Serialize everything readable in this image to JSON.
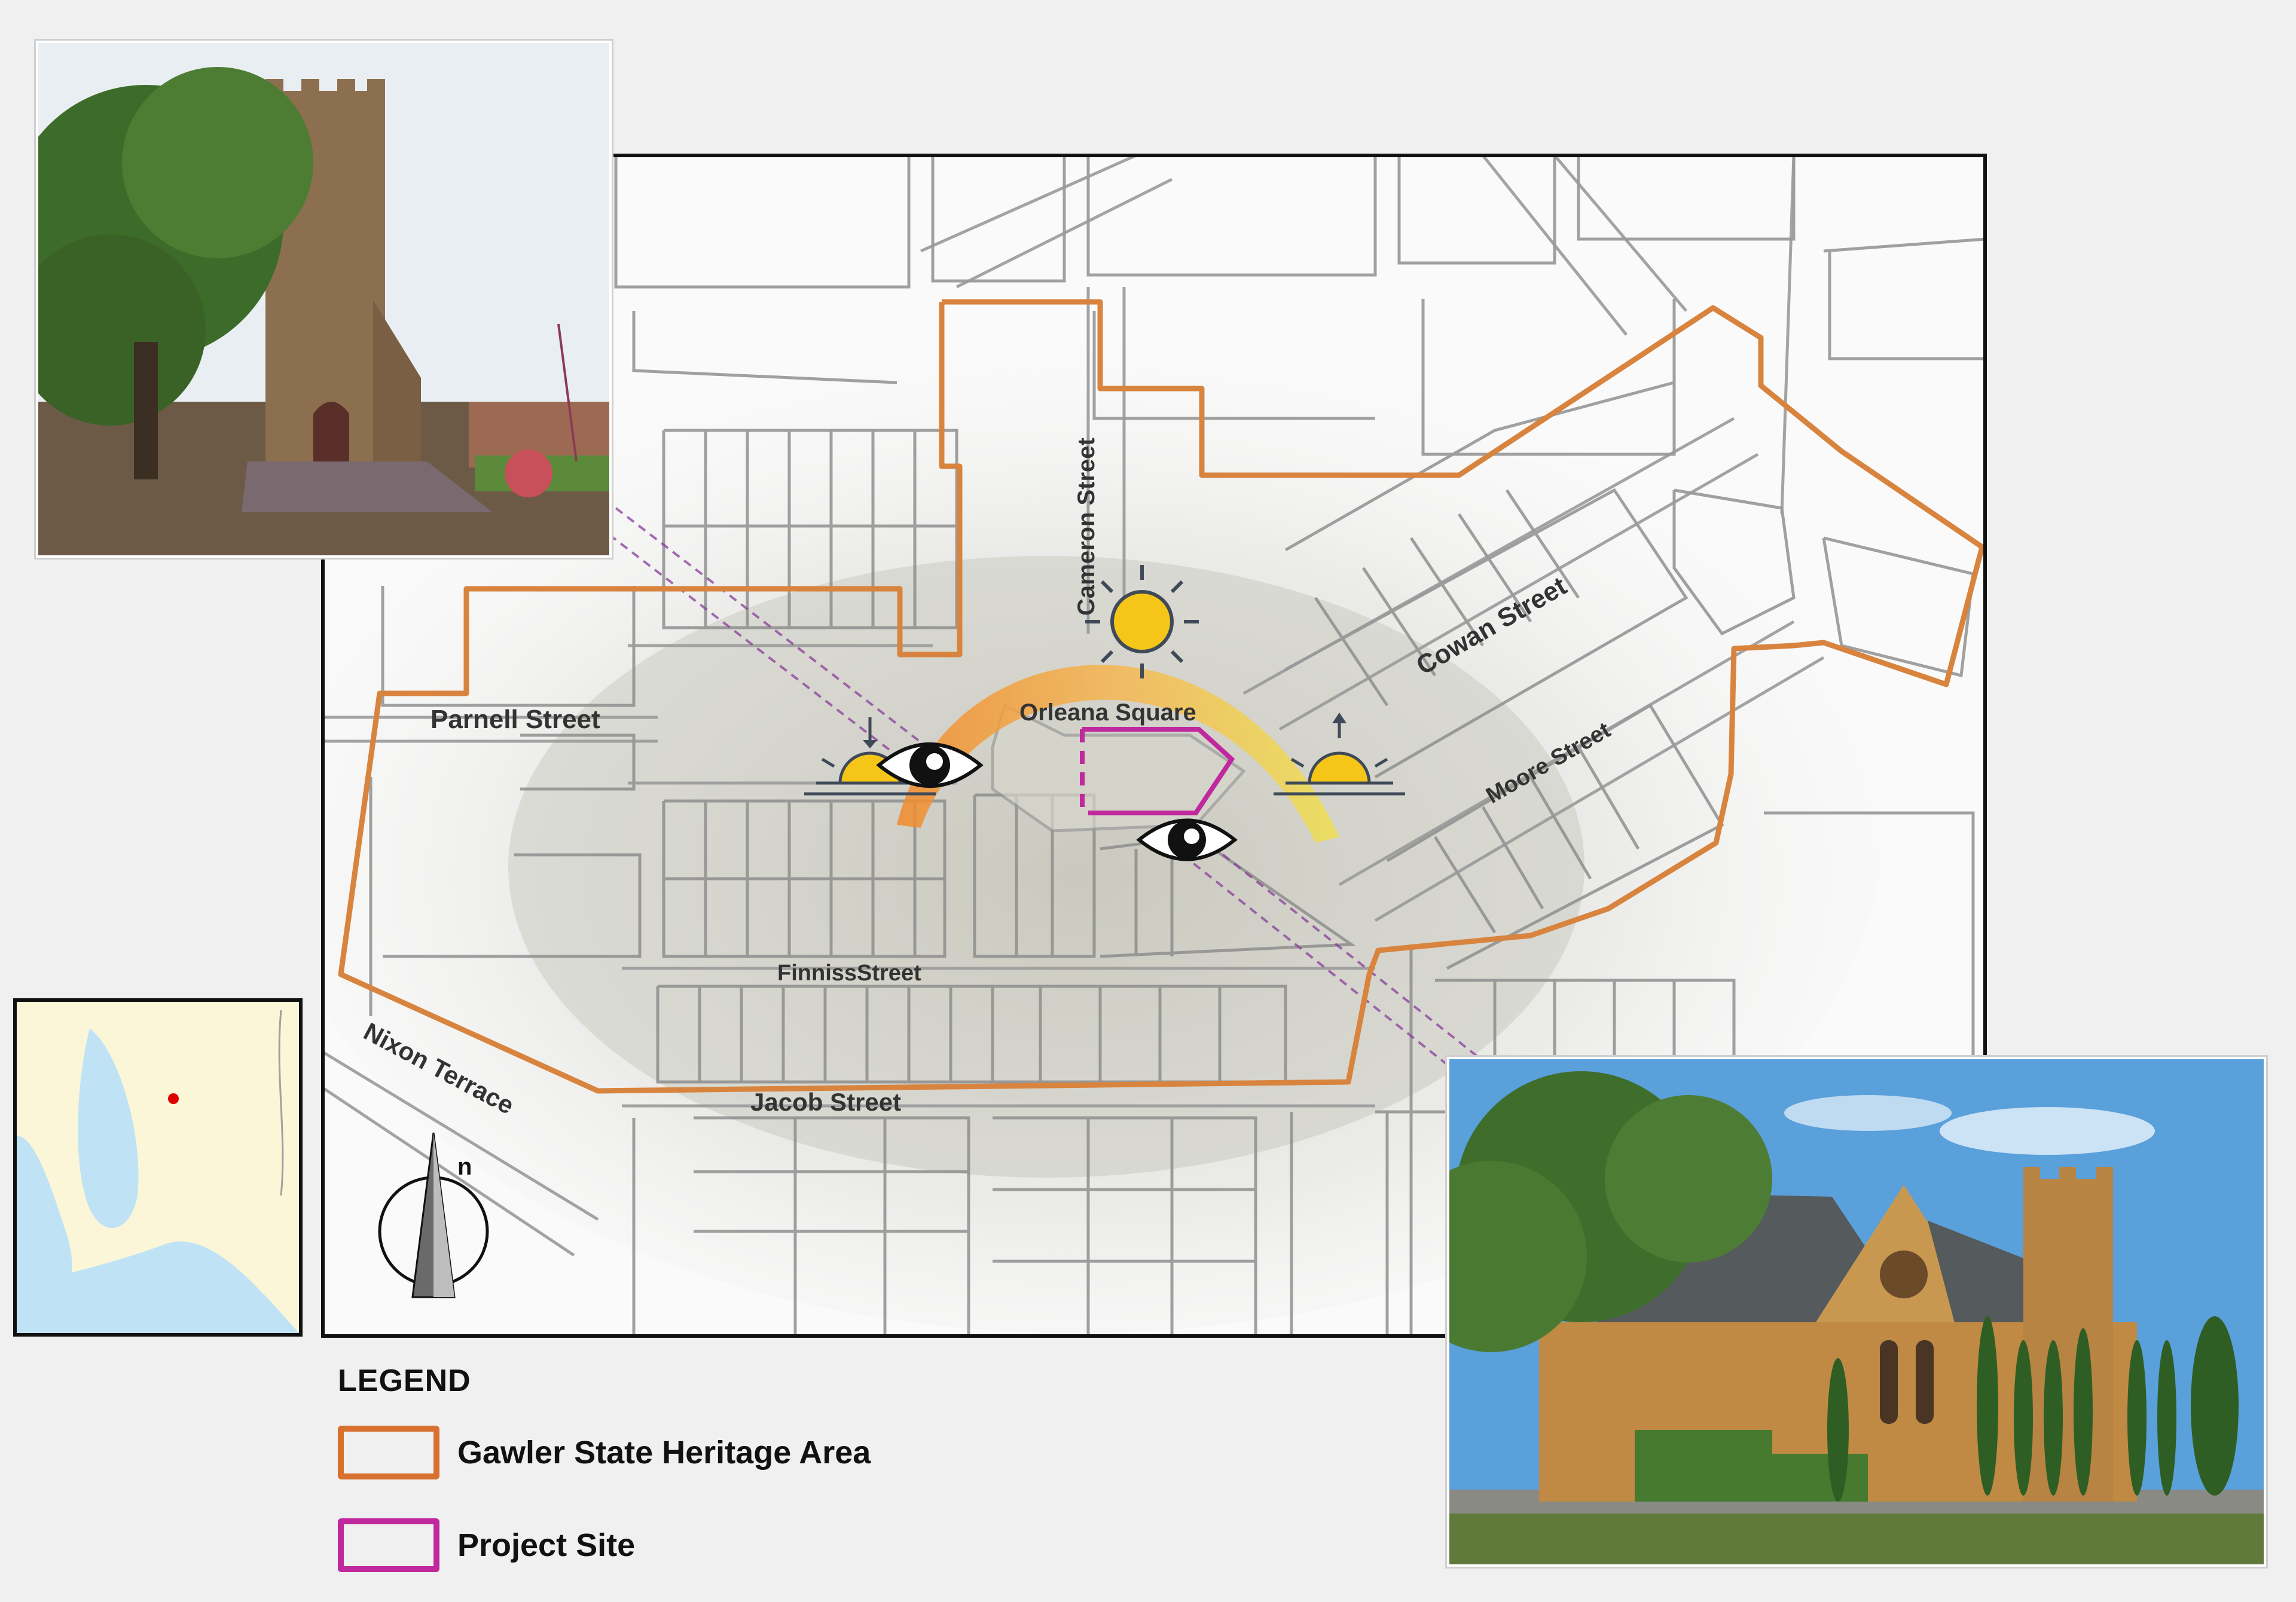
{
  "streets": {
    "cameron": "Cameron Street",
    "cowan": "Cowan Street",
    "parnell": "Parnell Street",
    "orleana": "Orleana Square",
    "moore": "Moore Street",
    "finniss": "FinnissStreet",
    "nixon": "Nixon Terrace",
    "jacob": "Jacob Street"
  },
  "legend": {
    "title": "LEGEND",
    "items": [
      {
        "label": "Gawler State Heritage Area",
        "color": "#d8702f"
      },
      {
        "label": "Project Site",
        "color": "#c0289e"
      }
    ]
  },
  "colors": {
    "heritage_boundary": "#d8843e",
    "project_site": "#c0289e",
    "sun_path": "#f2a23a",
    "sun": "#f5c518"
  },
  "icons": [
    "sun-icon",
    "sunrise-icon",
    "sunset-icon",
    "eye-icon",
    "north-arrow-icon"
  ],
  "locator": {
    "marker_color": "#e00000"
  }
}
